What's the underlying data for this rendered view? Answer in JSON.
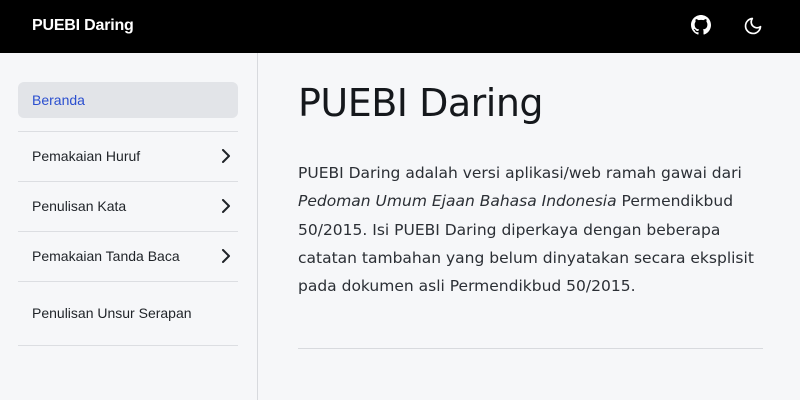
{
  "header": {
    "brand": "PUEBI Daring",
    "github_icon": "github-icon",
    "theme_icon": "moon-icon"
  },
  "sidebar": {
    "active": "Beranda",
    "items": [
      {
        "label": "Pemakaian Huruf",
        "has_children": true
      },
      {
        "label": "Penulisan Kata",
        "has_children": true
      },
      {
        "label": "Pemakaian Tanda Baca",
        "has_children": true
      },
      {
        "label": "Penulisan Unsur Serapan",
        "has_children": false
      }
    ]
  },
  "main": {
    "title": "PUEBI Daring",
    "para_part1": "PUEBI Daring adalah versi aplikasi/web ramah gawai dari ",
    "para_italic": "Pedoman Umum Ejaan Bahasa Indonesia",
    "para_part2": " Permendikbud 50/2015. Isi PUEBI Daring diperkaya dengan beberapa catatan tambahan yang belum dinyatakan secara eksplisit pada dokumen asli Permendikbud 50/2015."
  },
  "colors": {
    "topbar": "#000000",
    "active_link": "#2b4fcf",
    "background": "#f6f7f9"
  }
}
